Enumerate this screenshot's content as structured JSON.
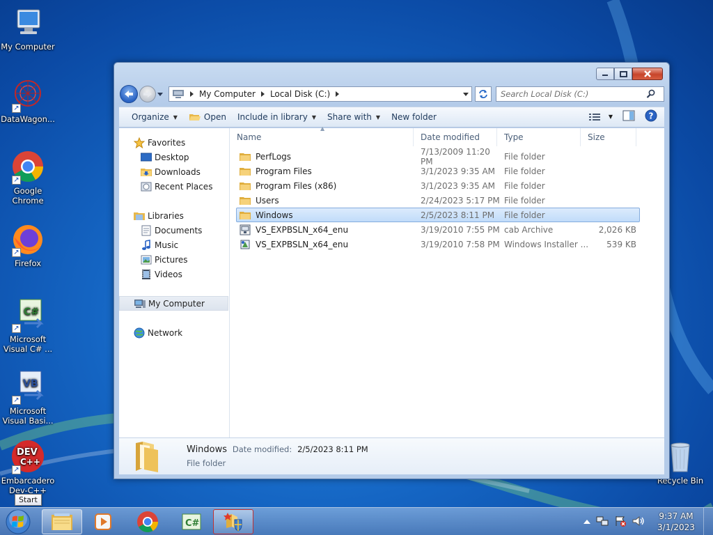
{
  "desktop": {
    "icons": [
      {
        "label": "My Computer"
      },
      {
        "label": "DataWagon..."
      },
      {
        "label": "Google Chrome"
      },
      {
        "label": "Firefox"
      },
      {
        "label": "Microsoft Visual C# ..."
      },
      {
        "label": "Microsoft Visual Basi..."
      },
      {
        "label": "Embarcadero Dev-C++"
      },
      {
        "label": "Recycle Bin"
      }
    ]
  },
  "explorer": {
    "breadcrumb": [
      "My Computer",
      "Local Disk (C:)"
    ],
    "search_placeholder": "Search Local Disk (C:)",
    "toolbar": {
      "organize": "Organize",
      "open": "Open",
      "include_in_library": "Include in library",
      "share_with": "Share with",
      "new_folder": "New folder"
    },
    "nav": {
      "favorites": "Favorites",
      "desktop": "Desktop",
      "downloads": "Downloads",
      "recent_places": "Recent Places",
      "libraries": "Libraries",
      "documents": "Documents",
      "music": "Music",
      "pictures": "Pictures",
      "videos": "Videos",
      "my_computer": "My Computer",
      "network": "Network"
    },
    "columns": {
      "name": "Name",
      "date": "Date modified",
      "type": "Type",
      "size": "Size"
    },
    "files": [
      {
        "name": "PerfLogs",
        "date": "7/13/2009 11:20 PM",
        "type": "File folder",
        "size": ""
      },
      {
        "name": "Program Files",
        "date": "3/1/2023 9:35 AM",
        "type": "File folder",
        "size": ""
      },
      {
        "name": "Program Files (x86)",
        "date": "3/1/2023 9:35 AM",
        "type": "File folder",
        "size": ""
      },
      {
        "name": "Users",
        "date": "2/24/2023 5:17 PM",
        "type": "File folder",
        "size": ""
      },
      {
        "name": "Windows",
        "date": "2/5/2023 8:11 PM",
        "type": "File folder",
        "size": ""
      },
      {
        "name": "VS_EXPBSLN_x64_enu",
        "date": "3/19/2010 7:55 PM",
        "type": "cab Archive",
        "size": "2,026 KB"
      },
      {
        "name": "VS_EXPBSLN_x64_enu",
        "date": "3/19/2010 7:58 PM",
        "type": "Windows Installer ...",
        "size": "539 KB"
      }
    ],
    "details": {
      "name": "Windows",
      "date_label": "Date modified:",
      "date_value": "2/5/2023 8:11 PM",
      "type": "File folder"
    }
  },
  "taskbar": {
    "start_tooltip": "Start",
    "clock_time": "9:37 AM",
    "clock_date": "3/1/2023"
  }
}
